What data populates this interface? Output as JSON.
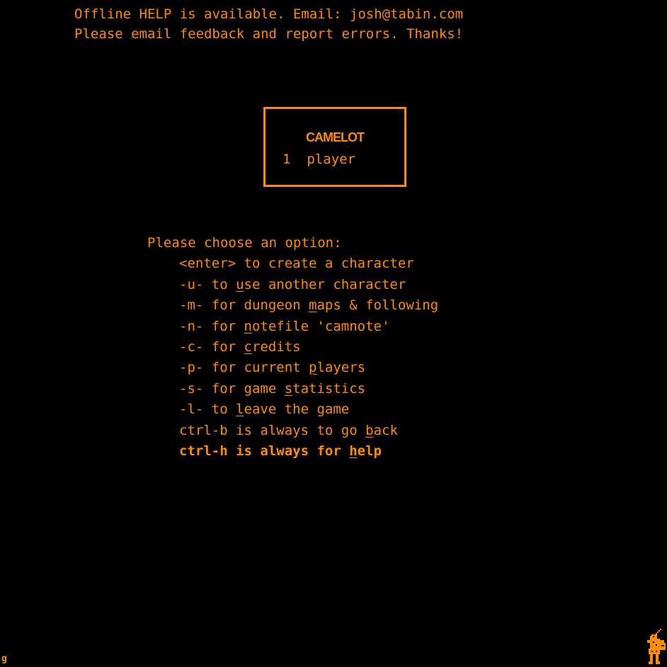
{
  "header": {
    "line1": "Offline HELP is available. Email: josh@tabin.com",
    "line2": "Please email feedback and report errors. Thanks!"
  },
  "title_box": {
    "title": "CAMELOT",
    "players": "1  player"
  },
  "menu": {
    "prompt": "Please choose an option:",
    "options": [
      {
        "pre": "<enter> to create a character",
        "u": "",
        "post": ""
      },
      {
        "pre": "-u- to ",
        "u": "u",
        "post": "se another character"
      },
      {
        "pre": "-m- for dungeon ",
        "u": "m",
        "post": "aps & following"
      },
      {
        "pre": "-n- for ",
        "u": "n",
        "post": "otefile 'camnote'"
      },
      {
        "pre": "-c- for ",
        "u": "c",
        "post": "redits"
      },
      {
        "pre": "-p- for current ",
        "u": "p",
        "post": "layers"
      },
      {
        "pre": "-s- for game ",
        "u": "s",
        "post": "tatistics"
      },
      {
        "pre": "-l- to ",
        "u": "l",
        "post": "eave the game"
      },
      {
        "pre": "ctrl-b is always to go ",
        "u": "b",
        "post": "ack"
      },
      {
        "pre": "ctrl-h is always for ",
        "u": "h",
        "post": "elp"
      }
    ]
  },
  "corner_glyph": "g",
  "icons": {
    "knight": "knight-icon"
  },
  "colors": {
    "background": "#000000",
    "foreground": "#ff8c00"
  }
}
